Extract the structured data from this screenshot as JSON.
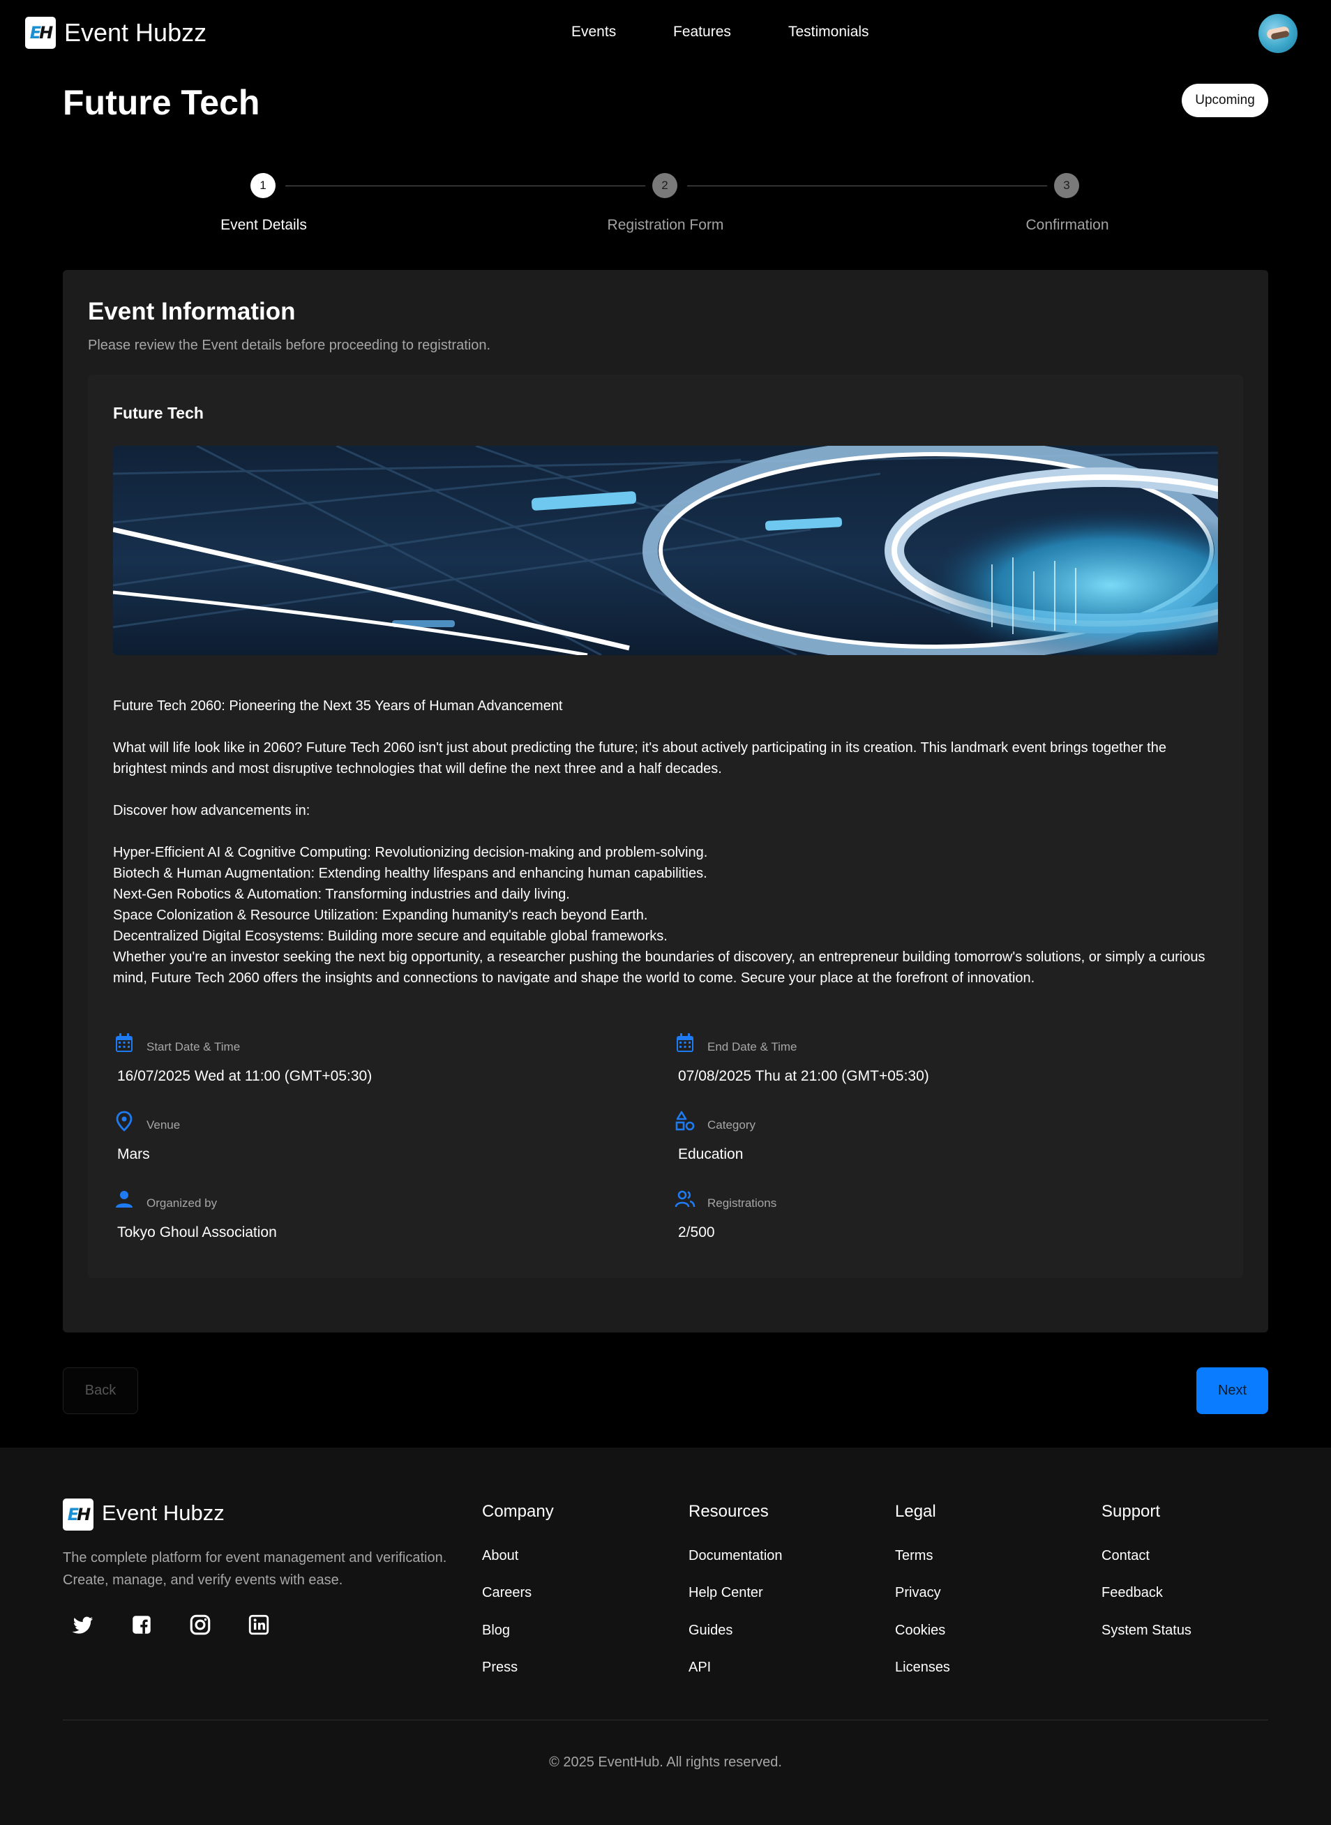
{
  "nav": {
    "logo_text": "EH",
    "brand": "Event Hubzz",
    "links": [
      "Events",
      "Features",
      "Testimonials"
    ],
    "avatar_icon": "handshake-avatar"
  },
  "event": {
    "title": "Future Tech",
    "status": "Upcoming"
  },
  "stepper": {
    "steps": [
      {
        "number": "1",
        "label": "Event Details",
        "state": "active"
      },
      {
        "number": "2",
        "label": "Registration Form",
        "state": "inactive"
      },
      {
        "number": "3",
        "label": "Confirmation",
        "state": "inactive"
      }
    ]
  },
  "card": {
    "title": "Event Information",
    "subtitle": "Please review the Event details before proceeding to registration.",
    "event_name": "Future Tech",
    "description": {
      "headline": "Future Tech 2060: Pioneering the Next 35 Years of Human Advancement",
      "intro": "What will life look like in 2060? Future Tech 2060 isn't just about predicting the future; it's about actively participating in its creation. This landmark event brings together the brightest minds and most disruptive technologies that will define the next three and a half decades.",
      "lead": "Discover how advancements in:",
      "points": [
        "Hyper-Efficient AI & Cognitive Computing: Revolutionizing decision-making and problem-solving.",
        "Biotech & Human Augmentation: Extending healthy lifespans and enhancing human capabilities.",
        "Next-Gen Robotics & Automation: Transforming industries and daily living.",
        "Space Colonization & Resource Utilization: Expanding humanity's reach beyond Earth.",
        "Decentralized Digital Ecosystems: Building more secure and equitable global frameworks."
      ],
      "closing": "Whether you're an investor seeking the next big opportunity, a researcher pushing the boundaries of discovery, an entrepreneur building tomorrow's solutions, or simply a curious mind, Future Tech 2060 offers the insights and connections to navigate and shape the world to come. Secure your place at the forefront of innovation."
    },
    "details": {
      "start": {
        "label": "Start Date & Time",
        "value": "16/07/2025 Wed at 11:00 (GMT+05:30)",
        "icon": "calendar-icon"
      },
      "end": {
        "label": "End Date & Time",
        "value": "07/08/2025 Thu at 21:00 (GMT+05:30)",
        "icon": "calendar-icon"
      },
      "venue": {
        "label": "Venue",
        "value": "Mars",
        "icon": "location-pin-icon"
      },
      "category": {
        "label": "Category",
        "value": "Education",
        "icon": "shapes-icon"
      },
      "organizer": {
        "label": "Organized by",
        "value": "Tokyo Ghoul Association",
        "icon": "person-icon"
      },
      "registrations": {
        "label": "Registrations",
        "value": "2/500",
        "icon": "people-icon"
      }
    }
  },
  "buttons": {
    "back": "Back",
    "next": "Next"
  },
  "footer": {
    "brand": "Event Hubzz",
    "description": "The complete platform for event management and verification. Create, manage, and verify events with ease.",
    "social": [
      "twitter-icon",
      "facebook-icon",
      "instagram-icon",
      "linkedin-icon"
    ],
    "columns": [
      {
        "title": "Company",
        "links": [
          "About",
          "Careers",
          "Blog",
          "Press"
        ]
      },
      {
        "title": "Resources",
        "links": [
          "Documentation",
          "Help Center",
          "Guides",
          "API"
        ]
      },
      {
        "title": "Legal",
        "links": [
          "Terms",
          "Privacy",
          "Cookies",
          "Licenses"
        ]
      },
      {
        "title": "Support",
        "links": [
          "Contact",
          "Feedback",
          "System Status"
        ]
      }
    ],
    "copyright": "© 2025 EventHub. All rights reserved."
  },
  "colors": {
    "accent": "#0a7cff",
    "background": "#000000",
    "card": "#1c1c1c",
    "footer": "#121212"
  }
}
